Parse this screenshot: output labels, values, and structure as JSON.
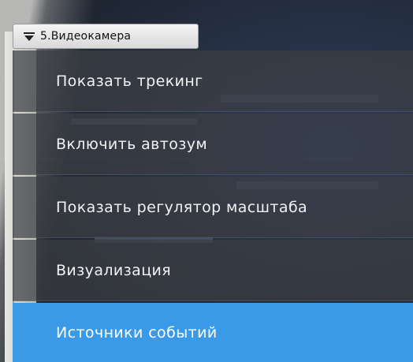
{
  "camera": {
    "title": "5.Видеокамера",
    "menu_icon": "chevron-down-icon"
  },
  "menu": {
    "items": [
      {
        "label": "Показать трекинг",
        "active": false
      },
      {
        "label": "Включить автозум",
        "active": false
      },
      {
        "label": "Показать регулятор масштаба",
        "active": false
      },
      {
        "label": "Визуализация",
        "active": false
      },
      {
        "label": "Источники событий",
        "active": true
      }
    ]
  },
  "colors": {
    "menu_bg": "#3c3e42",
    "menu_active": "#3a9ae8",
    "menu_text": "#f2f2f2"
  }
}
